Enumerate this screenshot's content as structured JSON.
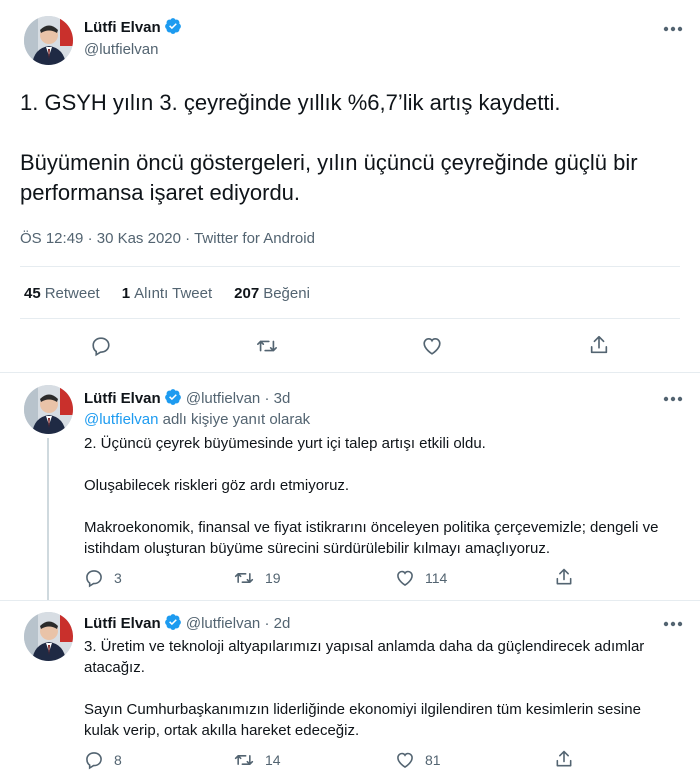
{
  "main_tweet": {
    "author_name": "Lütfi Elvan",
    "handle": "@lutfielvan",
    "text": "1. GSYH yılın 3. çeyreğinde yıllık %6,7’lik artış kaydetti.\n\nBüyümenin öncü göstergeleri, yılın üçüncü çeyreğinde güçlü bir performansa işaret ediyordu.",
    "time": "ÖS 12:49",
    "date": "30 Kas 2020",
    "source": "Twitter for Android",
    "retweet_count": "45",
    "retweet_label": "Retweet",
    "quote_count": "1",
    "quote_label": "Alıntı Tweet",
    "like_count": "207",
    "like_label": "Beğeni"
  },
  "replies": [
    {
      "author_name": "Lütfi Elvan",
      "handle": "@lutfielvan",
      "age": "3d",
      "reply_to_handle": "@lutfielvan",
      "reply_to_suffix": " adlı kişiye yanıt olarak",
      "text": "2. Üçüncü çeyrek büyümesinde yurt içi talep artışı etkili oldu.\n\nOluşabilecek riskleri göz ardı etmiyoruz.\n\nMakroekonomik, finansal ve fiyat istikrarını önceleyen politika çerçevemizle; dengeli ve istihdam oluşturan büyüme sürecini sürdürülebilir kılmayı amaçlıyoruz.",
      "replies": "3",
      "retweets": "19",
      "likes": "114"
    },
    {
      "author_name": "Lütfi Elvan",
      "handle": "@lutfielvan",
      "age": "2d",
      "text": "3. Üretim ve teknoloji altyapılarımızı yapısal anlamda daha da güçlendirecek adımlar atacağız.\n\nSayın Cumhurbaşkanımızın liderliğinde ekonomiyi ilgilendiren tüm kesimlerin sesine kulak verip, ortak akılla hareket edeceğiz.",
      "replies": "8",
      "retweets": "14",
      "likes": "81"
    }
  ],
  "separator": "·",
  "colors": {
    "accent": "#1d9bf0",
    "muted": "#536471",
    "text": "#0f1419"
  },
  "icons": [
    "verified-badge-icon",
    "more-options-icon",
    "reply-icon",
    "retweet-icon",
    "like-icon",
    "share-icon"
  ]
}
